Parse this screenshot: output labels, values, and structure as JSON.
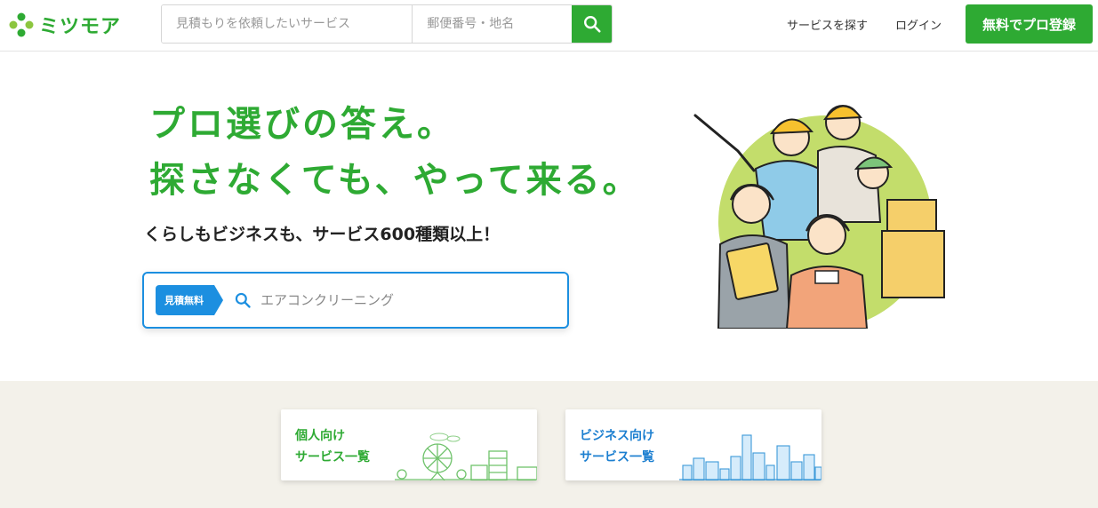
{
  "header": {
    "logo_text": "ミツモア",
    "logo_icon": "clover-logo-icon",
    "service_placeholder": "見積もりを依頼したいサービス",
    "area_placeholder": "郵便番号・地名",
    "search_icon": "search-icon",
    "nav_find": "サービスを探す",
    "nav_login": "ログイン",
    "register_label": "無料でプロ登録"
  },
  "hero": {
    "headline_1": "プロ選びの答え。",
    "headline_2": "探さなくても、やって来る。",
    "subhead": "くらしもビジネスも、サービス600種類以上！",
    "badge": "見積無料",
    "search_placeholder": "エアコンクリーニング",
    "illustration": "professionals-illustration"
  },
  "cards": {
    "personal_line1": "個人向け",
    "personal_line2": "サービス一覧",
    "business_line1": "ビジネス向け",
    "business_line2": "サービス一覧"
  },
  "colors": {
    "brand_green": "#2eaa33",
    "accent_blue": "#1c8fe0",
    "section_bg": "#f3f1ea"
  }
}
